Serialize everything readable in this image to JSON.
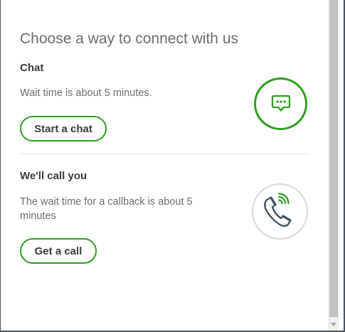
{
  "dialog": {
    "title": "Choose a way to connect with us"
  },
  "chat": {
    "heading": "Chat",
    "description": "Wait time is about 5 minutes.",
    "button_label": "Start a chat",
    "icon": "chat-bubble-icon"
  },
  "call": {
    "heading": "We'll call you",
    "description": "The wait time for a callback is about 5 minutes",
    "button_label": "Get a call",
    "icon": "phone-icon"
  },
  "colors": {
    "accent_green": "#2ca01c",
    "text_dark": "#393a3d",
    "text_gray": "#6b6c72"
  }
}
